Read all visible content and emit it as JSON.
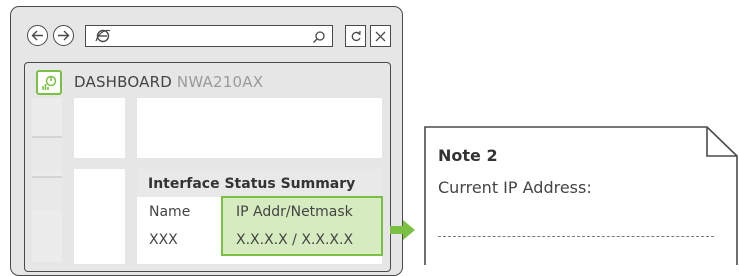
{
  "browser": {
    "back_icon": "back-arrow-icon",
    "forward_icon": "forward-arrow-icon",
    "address_icon": "browser-logo-icon",
    "search_icon": "search-icon",
    "refresh_icon": "refresh-icon",
    "close_icon": "close-icon"
  },
  "dashboard": {
    "title": "DASHBOARD",
    "model": "NWA210AX",
    "icon": "dashboard-chart-icon"
  },
  "summary": {
    "title": "Interface Status Summary",
    "headers": [
      "Name",
      "IP Addr/Netmask"
    ],
    "row": [
      "XXX",
      "X.X.X.X / X.X.X.X"
    ]
  },
  "note": {
    "title": "Note 2",
    "text": "Current IP Address:"
  },
  "colors": {
    "accent_green": "#7ac143",
    "highlight_fill": "#d6ebbf",
    "outline": "#4a4a4a"
  }
}
